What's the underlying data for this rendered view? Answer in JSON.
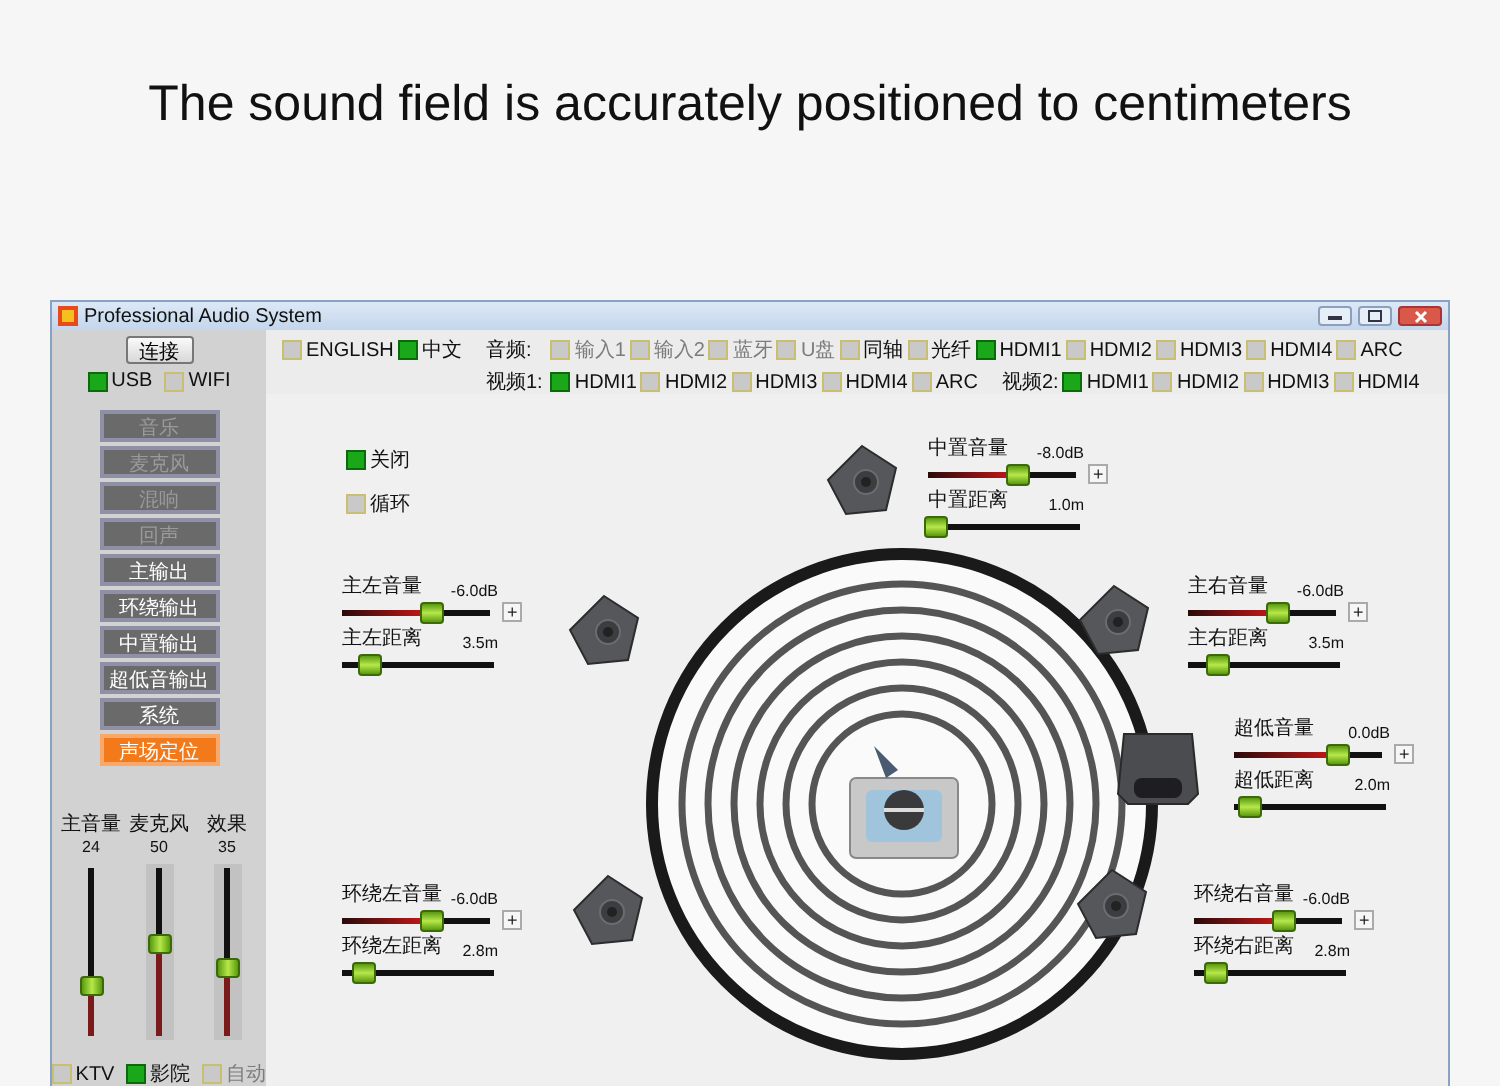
{
  "headline": "The sound field is accurately positioned to centimeters",
  "window": {
    "title": "Professional Audio System"
  },
  "sidebar": {
    "connect_button": "连接",
    "connection": [
      {
        "label": "USB",
        "checked": true
      },
      {
        "label": "WIFI",
        "checked": false
      }
    ],
    "menu": [
      {
        "label": "音乐",
        "disabled": true,
        "selected": false
      },
      {
        "label": "麦克风",
        "disabled": true,
        "selected": false
      },
      {
        "label": "混响",
        "disabled": true,
        "selected": false
      },
      {
        "label": "回声",
        "disabled": true,
        "selected": false
      },
      {
        "label": "主输出",
        "disabled": false,
        "selected": false
      },
      {
        "label": "环绕输出",
        "disabled": false,
        "selected": false
      },
      {
        "label": "中置输出",
        "disabled": false,
        "selected": false
      },
      {
        "label": "超低音输出",
        "disabled": false,
        "selected": false
      },
      {
        "label": "系统",
        "disabled": false,
        "selected": false
      },
      {
        "label": "声场定位",
        "disabled": false,
        "selected": true
      }
    ],
    "faders": [
      {
        "label": "主音量",
        "reading": "24",
        "level": 0.3
      },
      {
        "label": "麦克风",
        "reading": "50",
        "level": 0.55
      },
      {
        "label": "效果",
        "reading": "35",
        "level": 0.41
      }
    ],
    "modes": [
      {
        "label": "KTV",
        "checked": false,
        "disabled": false
      },
      {
        "label": "影院",
        "checked": true,
        "disabled": false
      },
      {
        "label": "自动",
        "checked": false,
        "disabled": true
      }
    ]
  },
  "language": [
    {
      "label": "ENGLISH",
      "checked": false
    },
    {
      "label": "中文",
      "checked": true
    }
  ],
  "audio_source": {
    "label": "音频:",
    "options": [
      {
        "label": "输入1",
        "checked": false,
        "disabled": true
      },
      {
        "label": "输入2",
        "checked": false,
        "disabled": true
      },
      {
        "label": "蓝牙",
        "checked": false,
        "disabled": true
      },
      {
        "label": "U盘",
        "checked": false,
        "disabled": true
      },
      {
        "label": "同轴",
        "checked": false,
        "disabled": false
      },
      {
        "label": "光纤",
        "checked": false,
        "disabled": false
      },
      {
        "label": "HDMI1",
        "checked": true,
        "disabled": false
      },
      {
        "label": "HDMI2",
        "checked": false,
        "disabled": false
      },
      {
        "label": "HDMI3",
        "checked": false,
        "disabled": false
      },
      {
        "label": "HDMI4",
        "checked": false,
        "disabled": false
      },
      {
        "label": "ARC",
        "checked": false,
        "disabled": false
      }
    ]
  },
  "video_1": {
    "label": "视频1:",
    "options": [
      {
        "label": "HDMI1",
        "checked": true
      },
      {
        "label": "HDMI2",
        "checked": false
      },
      {
        "label": "HDMI3",
        "checked": false
      },
      {
        "label": "HDMI4",
        "checked": false
      },
      {
        "label": "ARC",
        "checked": false
      }
    ]
  },
  "video_2": {
    "label": "视频2:",
    "options": [
      {
        "label": "HDMI1",
        "checked": true
      },
      {
        "label": "HDMI2",
        "checked": false
      },
      {
        "label": "HDMI3",
        "checked": false
      },
      {
        "label": "HDMI4",
        "checked": false
      }
    ]
  },
  "toggles": [
    {
      "label": "关闭",
      "checked": true
    },
    {
      "label": "循环",
      "checked": false
    }
  ],
  "channels": [
    {
      "name": "中置音量",
      "reading": "-8.0dB",
      "level": 0.6,
      "plus": "+",
      "distance_label": "中置距离",
      "distance": "1.0m",
      "distance_slider": {
        "level": 0.05
      }
    },
    {
      "name": "主左音量",
      "reading": "-6.0dB",
      "level": 0.6,
      "plus": "+",
      "distance_label": "主左距离",
      "distance": "3.5m",
      "distance_slider": {
        "level": 0.18
      }
    },
    {
      "name": "主右音量",
      "reading": "-6.0dB",
      "level": 0.6,
      "plus": "+",
      "distance_label": "主右距离",
      "distance": "3.5m",
      "distance_slider": {
        "level": 0.2
      }
    },
    {
      "name": "超低音量",
      "reading": "0.0dB",
      "level": 0.7,
      "plus": "+",
      "distance_label": "超低距离",
      "distance": "2.0m",
      "distance_slider": {
        "level": 0.1
      }
    },
    {
      "name": "环绕左音量",
      "reading": "-6.0dB",
      "level": 0.6,
      "plus": "+",
      "distance_label": "环绕左距离",
      "distance": "2.8m",
      "distance_slider": {
        "level": 0.15
      }
    },
    {
      "name": "环绕右音量",
      "reading": "-6.0dB",
      "level": 0.6,
      "plus": "+",
      "distance_label": "环绕右距离",
      "distance": "2.8m",
      "distance_slider": {
        "level": 0.15
      }
    }
  ]
}
